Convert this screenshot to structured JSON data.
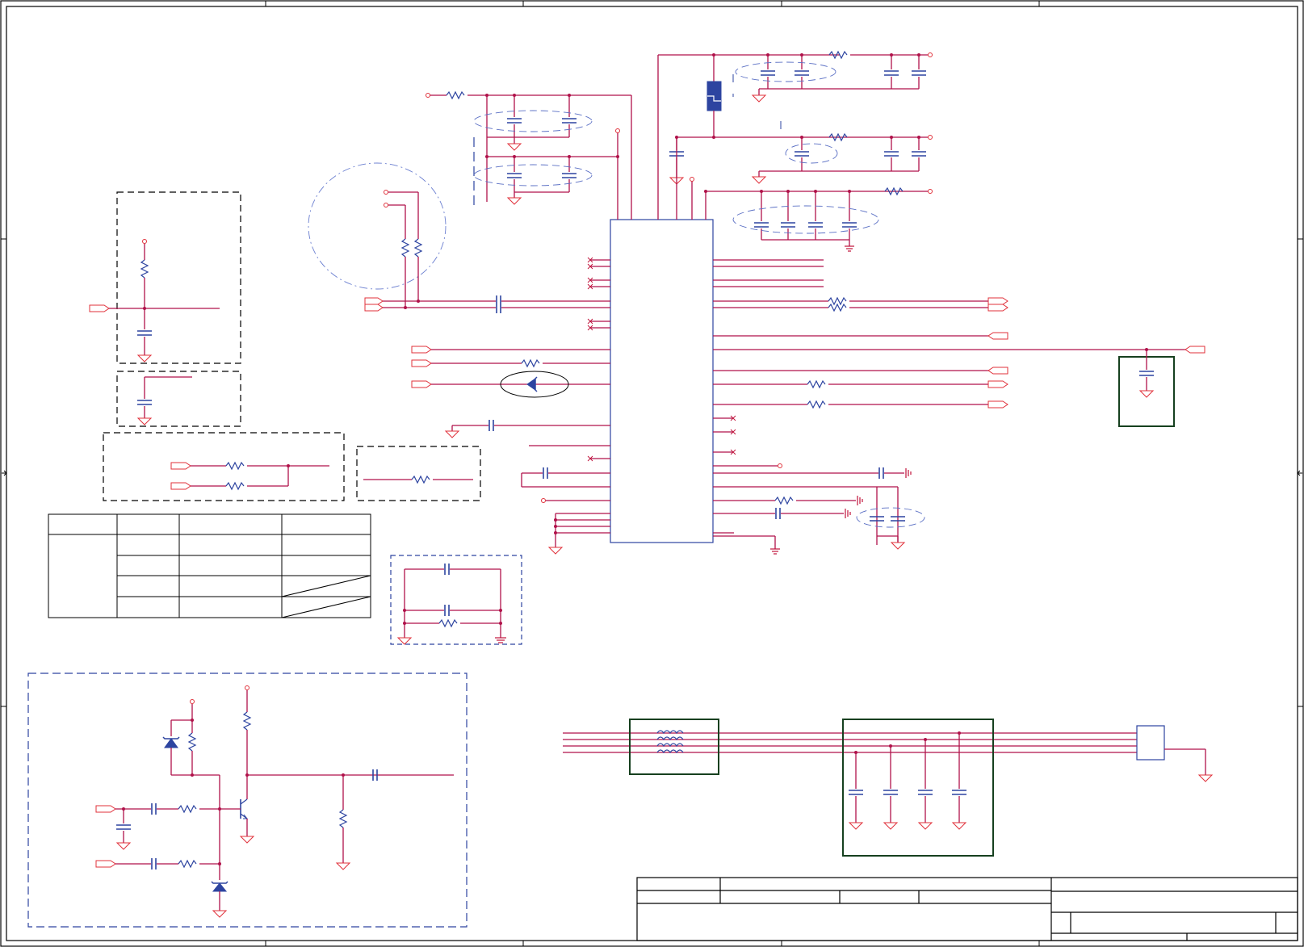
{
  "page": {
    "background": "#ffffff"
  },
  "colors": {
    "wire": "#b0124a",
    "component": "#2d44a0",
    "port_outline": "#e0303a",
    "group_box_green": "#16401f",
    "frame": "#000000"
  },
  "icons": {
    "resistor": "resistor-icon",
    "capacitor": "capacitor-icon",
    "ground": "ground-icon",
    "net_port": "net-port-icon",
    "no_connect": "no-connect-icon",
    "zener_diode": "zener-diode-icon",
    "npn_transistor": "npn-transistor-icon",
    "ferrite_inductor": "inductor-icon",
    "crystal": "crystal-icon"
  }
}
